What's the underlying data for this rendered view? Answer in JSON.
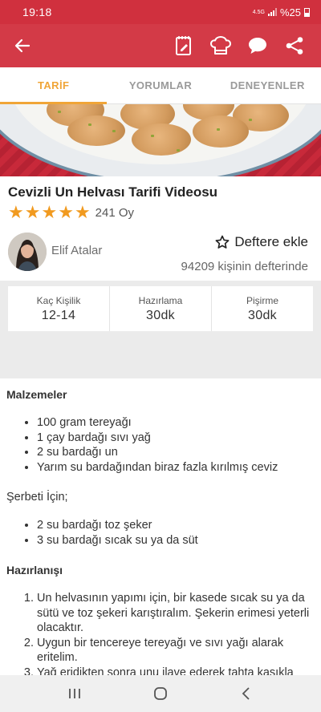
{
  "status_bar": {
    "time": "19:18",
    "network": "4.5G",
    "battery": "%25"
  },
  "toolbar": {
    "back_icon": "arrow-left-icon",
    "actions": [
      "notebook-edit-icon",
      "chef-hat-icon",
      "chat-bubble-icon",
      "share-icon"
    ]
  },
  "tabs": [
    {
      "label": "TARİF",
      "active": true
    },
    {
      "label": "YORUMLAR",
      "active": false
    },
    {
      "label": "DENEYENLER",
      "active": false
    }
  ],
  "recipe": {
    "title": "Cevizli Un Helvası Tarifi Videosu",
    "rating": 5,
    "votes": "241 Oy",
    "author": "Elif Atalar",
    "favorite_label": "Deftere ekle",
    "favorite_count": "94209 kişinin defterinde"
  },
  "meta": [
    {
      "label": "Kaç Kişilik",
      "value": "12-14"
    },
    {
      "label": "Hazırlama",
      "value": "30dk"
    },
    {
      "label": "Pişirme",
      "value": "30dk"
    }
  ],
  "content": {
    "ingredients_heading": "Malzemeler",
    "ingredients": [
      "100 gram tereyağı",
      "1 çay bardağı sıvı yağ",
      "2 su bardağı un",
      "Yarım su bardağından biraz fazla kırılmış ceviz"
    ],
    "syrup_heading": "Şerbeti İçin;",
    "syrup": [
      "2 su bardağı toz şeker",
      "3 su bardağı sıcak su ya da süt"
    ],
    "steps_heading": "Hazırlanışı",
    "steps": [
      "Un helvasının yapımı için, bir kasede sıcak su ya da sütü ve toz şekeri karıştıralım. Şekerin erimesi yeterli olacaktır.",
      "Uygun bir tencereye tereyağı ve sıvı yağı alarak eritelim.",
      "Yağ eridikten sonra unu ilave ederek tahta kaşıkla"
    ]
  },
  "colors": {
    "primary": "#d33a47",
    "accent": "#f0a537",
    "star": "#f19a1f"
  },
  "nav_bar": [
    "recent-apps-icon",
    "home-icon",
    "back-icon"
  ]
}
